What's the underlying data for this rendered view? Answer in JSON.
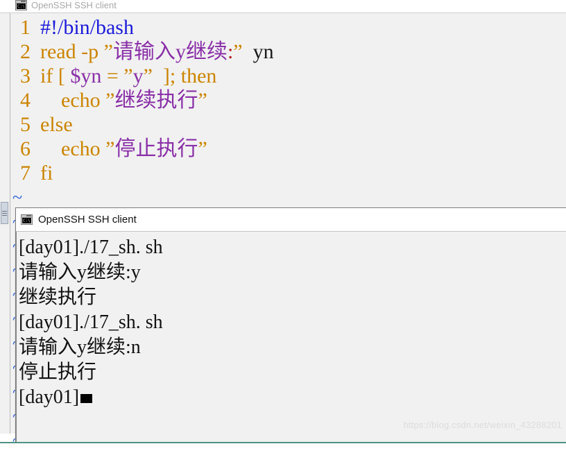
{
  "editor_window": {
    "title": "OpenSSH SSH client",
    "icon": "console-icon",
    "icon_label": "C:\\.",
    "code_lines": [
      {
        "number": "1",
        "tokens": [
          {
            "text": "#!/bin/bash",
            "type": "comment"
          }
        ]
      },
      {
        "number": "2",
        "tokens": [
          {
            "text": "read",
            "type": "keyword"
          },
          {
            "text": " ",
            "type": "plain"
          },
          {
            "text": "-p",
            "type": "keyword"
          },
          {
            "text": " ",
            "type": "plain"
          },
          {
            "text": "”",
            "type": "quote"
          },
          {
            "text": "请输入y继续",
            "type": "string"
          },
          {
            "text": ":",
            "type": "colon"
          },
          {
            "text": "”",
            "type": "quote"
          },
          {
            "text": "  ",
            "type": "plain"
          },
          {
            "text": "yn",
            "type": "plain"
          }
        ]
      },
      {
        "number": "3",
        "tokens": [
          {
            "text": "if",
            "type": "keyword"
          },
          {
            "text": " ",
            "type": "plain"
          },
          {
            "text": "[",
            "type": "punct"
          },
          {
            "text": " ",
            "type": "plain"
          },
          {
            "text": "$yn",
            "type": "var"
          },
          {
            "text": " ",
            "type": "plain"
          },
          {
            "text": "=",
            "type": "op"
          },
          {
            "text": " ",
            "type": "plain"
          },
          {
            "text": "”",
            "type": "quote"
          },
          {
            "text": "y",
            "type": "string"
          },
          {
            "text": "”",
            "type": "quote"
          },
          {
            "text": "  ",
            "type": "plain"
          },
          {
            "text": "]",
            "type": "punct"
          },
          {
            "text": ";",
            "type": "op"
          },
          {
            "text": " ",
            "type": "plain"
          },
          {
            "text": "then",
            "type": "keyword"
          }
        ]
      },
      {
        "number": "4",
        "tokens": [
          {
            "text": "    ",
            "type": "plain"
          },
          {
            "text": "echo",
            "type": "keyword"
          },
          {
            "text": " ",
            "type": "plain"
          },
          {
            "text": "”",
            "type": "quote"
          },
          {
            "text": "继续执行",
            "type": "string"
          },
          {
            "text": "”",
            "type": "quote"
          }
        ]
      },
      {
        "number": "5",
        "tokens": [
          {
            "text": "else",
            "type": "keyword"
          }
        ]
      },
      {
        "number": "6",
        "tokens": [
          {
            "text": "    ",
            "type": "plain"
          },
          {
            "text": "echo",
            "type": "keyword"
          },
          {
            "text": " ",
            "type": "plain"
          },
          {
            "text": "”",
            "type": "quote"
          },
          {
            "text": "停止执行",
            "type": "string"
          },
          {
            "text": "”",
            "type": "quote"
          }
        ]
      },
      {
        "number": "7",
        "tokens": [
          {
            "text": "fi",
            "type": "keyword"
          }
        ]
      }
    ],
    "empty_line_marker": "~",
    "empty_line_count": 11
  },
  "terminal_window": {
    "title": "OpenSSH SSH client",
    "icon": "console-icon",
    "icon_label": "C:\\.",
    "lines": [
      {
        "text": "[day01]./17_sh. sh",
        "cursor": false
      },
      {
        "text": "请输入y继续:y",
        "cursor": false
      },
      {
        "text": "继续执行",
        "cursor": false
      },
      {
        "text": "[day01]./17_sh. sh",
        "cursor": false
      },
      {
        "text": "请输入y继续:n",
        "cursor": false
      },
      {
        "text": "停止执行",
        "cursor": false
      },
      {
        "text": "[day01]",
        "cursor": true
      }
    ]
  },
  "watermark": {
    "text": "https://blog.csdn.net/weixin_43288201"
  },
  "colors": {
    "comment": "#1b1bdb",
    "keyword": "#cc8400",
    "string": "#8a2fa8",
    "quote": "#cc8400",
    "colon": "#b01b1b",
    "tilde": "#2a5fd8",
    "editor_bg": "#f1f1f1",
    "terminal_bg": "#f1f1f1",
    "bottom_edge": "#4c9184"
  }
}
